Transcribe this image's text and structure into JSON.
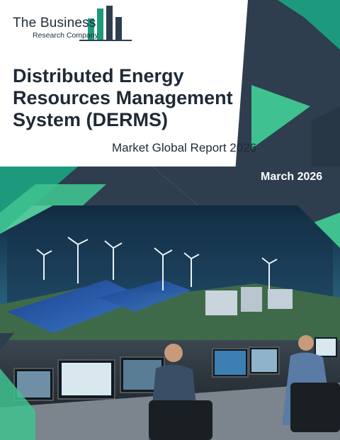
{
  "logo": {
    "name_line": "The Business",
    "tagline": "Research Company"
  },
  "report": {
    "title_lines": [
      "Distributed Energy",
      "Resources Management",
      "System (DERMS)"
    ],
    "subtitle": "Market Global Report 2026",
    "date": "March 2026"
  },
  "cover_image": {
    "description_icon": "control-room-photo-icon"
  },
  "colors": {
    "navy": "#2e3e4e",
    "teal": "#1d9a7e",
    "green": "#3fc28f",
    "dark_text": "#1e2a36",
    "white": "#ffffff"
  }
}
